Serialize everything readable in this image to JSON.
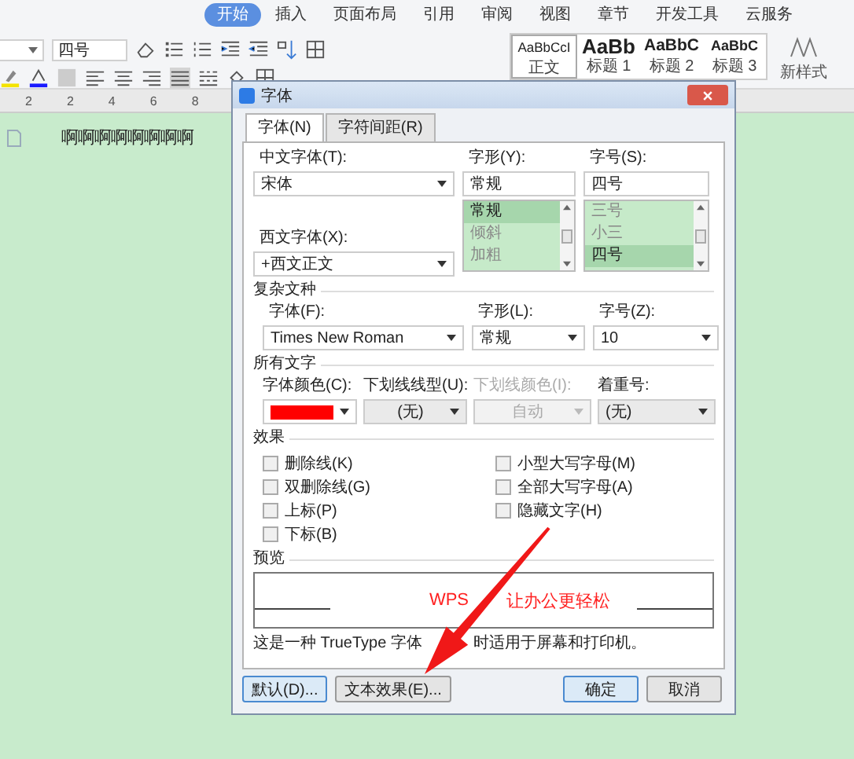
{
  "ribbon": {
    "tabs": [
      {
        "label": "开始",
        "selected": true
      },
      {
        "label": "插入",
        "selected": false
      },
      {
        "label": "页面布局",
        "selected": false
      },
      {
        "label": "引用",
        "selected": false
      },
      {
        "label": "审阅",
        "selected": false
      },
      {
        "label": "视图",
        "selected": false
      },
      {
        "label": "章节",
        "selected": false
      },
      {
        "label": "开发工具",
        "selected": false
      },
      {
        "label": "云服务",
        "selected": false
      }
    ],
    "font_size": "四号",
    "align_buttons": [
      {
        "selected": false
      },
      {
        "selected": false
      },
      {
        "selected": false
      },
      {
        "selected": true
      },
      {
        "selected": false
      }
    ],
    "styles": [
      {
        "sample": "AaBbCcI",
        "name": "正文",
        "kind": "normal"
      },
      {
        "sample": "AaBb",
        "name": "标题 1",
        "kind": "heading1"
      },
      {
        "sample": "AaBbC",
        "name": "标题 2",
        "kind": "heading2"
      },
      {
        "sample": "AaBbC",
        "name": "标题 3",
        "kind": "heading3"
      }
    ],
    "new_style": "新样式"
  },
  "ruler": {
    "marks": [
      "2",
      "2",
      "4",
      "6",
      "8"
    ]
  },
  "document": {
    "text": "啊啊啊啊啊啊啊啊"
  },
  "dialog": {
    "title": "字体",
    "tabs": [
      {
        "label": "字体(N)",
        "selected": true
      },
      {
        "label": "字符间距(R)",
        "selected": false
      }
    ],
    "chinese_font": {
      "label": "中文字体(T):",
      "value": "宋体"
    },
    "western_font": {
      "label": "西文字体(X):",
      "value": "+西文正文"
    },
    "style": {
      "label": "字形(Y):",
      "value": "常规",
      "options": [
        {
          "label": "常规",
          "selected": true
        },
        {
          "label": "倾斜",
          "selected": false
        },
        {
          "label": "加粗",
          "selected": false
        }
      ]
    },
    "size": {
      "label": "字号(S):",
      "value": "四号",
      "options": [
        {
          "label": "三号",
          "selected": false
        },
        {
          "label": "小三",
          "selected": false
        },
        {
          "label": "四号",
          "selected": true
        }
      ]
    },
    "complex_script": {
      "heading": "复杂文种",
      "font": {
        "label": "字体(F):",
        "value": "Times New Roman"
      },
      "style": {
        "label": "字形(L):",
        "value": "常规"
      },
      "size": {
        "label": "字号(Z):",
        "value": "10"
      }
    },
    "all_text": {
      "heading": "所有文字",
      "font_color": {
        "label": "字体颜色(C):",
        "color": "#ff0000"
      },
      "underline_style": {
        "label": "下划线线型(U):",
        "value": "(无)"
      },
      "underline_color": {
        "label": "下划线颜色(I):",
        "value": "自动",
        "disabled": true
      },
      "emphasis": {
        "label": "着重号:",
        "value": "(无)"
      }
    },
    "effects": {
      "heading": "效果",
      "options": [
        {
          "label": "删除线(K)",
          "checked": false
        },
        {
          "label": "双删除线(G)",
          "checked": false
        },
        {
          "label": "上标(P)",
          "checked": false
        },
        {
          "label": "下标(B)",
          "checked": false
        },
        {
          "label": "小型大写字母(M)",
          "checked": false
        },
        {
          "label": "全部大写字母(A)",
          "checked": false
        },
        {
          "label": "隐藏文字(H)",
          "checked": false
        }
      ]
    },
    "preview": {
      "heading": "预览",
      "sample_parts": [
        "WPS",
        "让办公更轻松"
      ],
      "note_parts": [
        "这是一种 TrueType 字体",
        "时适用于屏幕和打印机。"
      ]
    },
    "buttons": [
      {
        "label": "默认(D)...",
        "kind": "left",
        "highlighted": true
      },
      {
        "label": "文本效果(E)...",
        "kind": "left",
        "highlighted": false
      },
      {
        "label": "确定",
        "kind": "right",
        "highlighted": true
      },
      {
        "label": "取消",
        "kind": "right",
        "highlighted": false
      }
    ]
  }
}
